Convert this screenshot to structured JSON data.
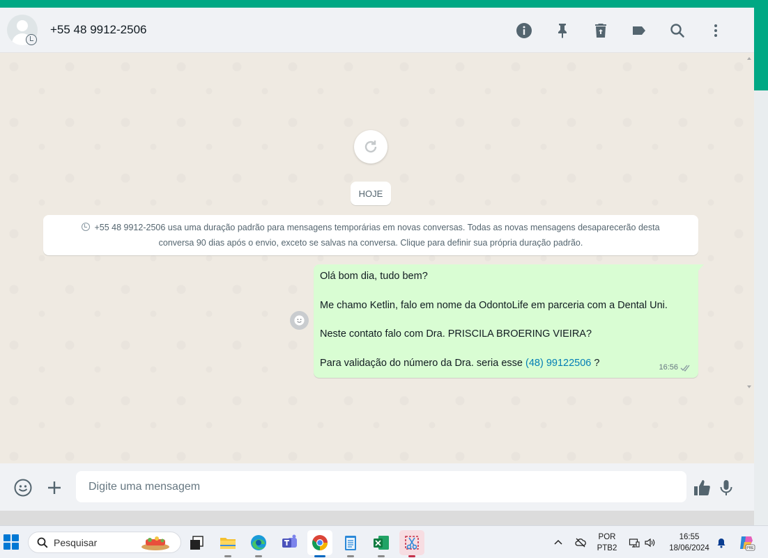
{
  "chat": {
    "contact_name": "+55 48 9912-2506",
    "header_icons": [
      "info-icon",
      "pin-icon",
      "trash-icon",
      "label-icon",
      "search-icon",
      "menu-dots-icon"
    ]
  },
  "messages": {
    "date_chip": "HOJE",
    "system_notice_line1": "+55 48 9912-2506 usa uma duração padrão para mensagens temporárias em novas conversas. Todas as novas mensagens desaparecerão desta",
    "system_notice_line2": "conversa 90 dias após o envio, exceto se salvas na conversa. Clique para definir sua própria duração padrão.",
    "outgoing": {
      "line1": "Olá bom dia, tudo bem?",
      "line2": "Me chamo Ketlin, falo em nome da OdontoLife em parceria com a Dental Uni.",
      "line3": "Neste contato falo com Dra. PRISCILA BROERING VIEIRA?",
      "line4_prefix": "Para validação do número da Dra. seria esse ",
      "line4_link": "(48) 99122506",
      "line4_suffix": " ?",
      "time": "16:56",
      "status": "delivered-double-check"
    }
  },
  "compose": {
    "placeholder": "Digite uma mensagem"
  },
  "taskbar": {
    "search_label": "Pesquisar",
    "language_line1": "POR",
    "language_line2": "PTB2",
    "clock_time": "16:55",
    "clock_date": "18/06/2024",
    "apps": [
      "task-view",
      "file-explorer",
      "edge",
      "teams",
      "chrome",
      "notepad",
      "excel",
      "snipping-tool"
    ],
    "active_app": "chrome"
  },
  "colors": {
    "accent": "#00a884",
    "outgoing_bubble": "#d9fdd3",
    "chat_background": "#efeae2",
    "link": "#027eb5"
  }
}
